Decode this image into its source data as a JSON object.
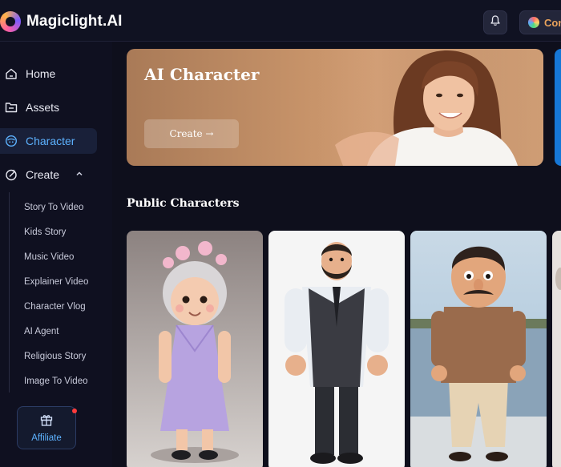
{
  "app": {
    "logo_text": "Magiclight.AI",
    "credit_label": "Con"
  },
  "sidebar": {
    "items": [
      {
        "label": "Home",
        "icon": "home-icon"
      },
      {
        "label": "Assets",
        "icon": "folder-icon"
      },
      {
        "label": "Character",
        "icon": "character-icon",
        "active": true
      },
      {
        "label": "Create",
        "icon": "create-icon",
        "expanded": true
      }
    ],
    "create_subitems": [
      "Story To Video",
      "Kids Story",
      "Music Video",
      "Explainer Video",
      "Character Vlog",
      "AI Agent",
      "Religious Story",
      "Image To Video"
    ],
    "affiliate_label": "Affiliate"
  },
  "banner": {
    "title": "AI Character",
    "create_button": "Create →"
  },
  "public_characters": {
    "title": "Public Characters",
    "cards": [
      {
        "icon": "grandma-character-image"
      },
      {
        "icon": "bearded-man-character-image"
      },
      {
        "icon": "mustache-man-character-image"
      },
      {
        "icon": "partial-character-image"
      }
    ]
  },
  "colors": {
    "accent": "#5db2ff",
    "background": "#0e0f1c",
    "banner": "#c8946a",
    "notification": "#ff3b3b"
  }
}
